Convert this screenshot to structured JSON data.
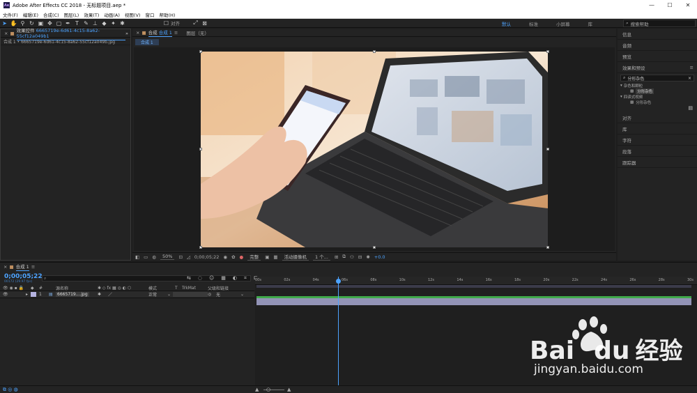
{
  "app": {
    "title": "Adobe After Effects CC 2018 - 无标题项目.aep *",
    "logo": "Ae"
  },
  "window_controls": [
    "—",
    "☐",
    "✕"
  ],
  "menu": [
    "文件(F)",
    "编辑(E)",
    "合成(C)",
    "图层(L)",
    "效果(T)",
    "动画(A)",
    "视图(V)",
    "窗口",
    "帮助(H)"
  ],
  "toolbar": {
    "align_label": "对齐",
    "workspaces": [
      "默认",
      "标准",
      "小屏幕",
      "库"
    ],
    "active_workspace": "默认",
    "search_help_placeholder": "搜索帮助"
  },
  "project_panel": {
    "tab_label": "效果控件",
    "tab_file": "6665719e-6d61-4c15-8a62-55cf12a049b1",
    "line": "合成 1 • 6665719e-6d61-4c15-8a62-55cf12a049b.jpg"
  },
  "comp_panel": {
    "tab_prefix": "合成",
    "tab_name": "合成 1",
    "layer_tab": "图层（无）",
    "subtab": "合成 1",
    "controls": {
      "zoom": "50%",
      "timecode": "0;00;05;22",
      "resolution": "完整",
      "camera": "活动摄像机",
      "views": "1 个...",
      "exposure": "+0.0"
    }
  },
  "right_panel": {
    "items_top": [
      "信息",
      "音频",
      "预览",
      "效果和预设"
    ],
    "effects_search": "分形杂色",
    "tree": [
      {
        "label": "杂色和颗粒",
        "level": 0
      },
      {
        "label": "分形杂色",
        "level": 1,
        "highlight": true
      },
      {
        "label": "四读式视频",
        "level": 0
      },
      {
        "label": "分形杂色",
        "level": 1,
        "highlight": false
      }
    ],
    "items_bottom": [
      "对齐",
      "库",
      "字符",
      "段落",
      "跟踪器"
    ]
  },
  "timeline": {
    "tab_label": "合成 1",
    "timecode": "0;00;05;22",
    "fps": "00172 (29.97 fps)",
    "search_placeholder": "",
    "columns": {
      "num": "#",
      "source": "源名称",
      "mode": "模式",
      "t": "T",
      "trkmat": "TrkMat",
      "parent": "父级和链接"
    },
    "layer": {
      "num": "1",
      "name": "6665719....jpg",
      "mode": "正常",
      "parent": "无"
    },
    "ruler_labels": [
      "00s",
      "02s",
      "04s",
      "06s",
      "08s",
      "10s",
      "12s",
      "14s",
      "16s",
      "18s",
      "20s",
      "22s",
      "24s",
      "26s",
      "28s",
      "30s"
    ],
    "playhead_seconds": 5.73
  },
  "watermark": {
    "brand": "Bai",
    "brand2": "du",
    "cn": "经验",
    "url": "jingyan.baidu.com"
  },
  "colors": {
    "accent": "#4da3ff",
    "layer_bar": "#9293b6",
    "green_bar": "#3fa84a",
    "panel": "#232323"
  }
}
